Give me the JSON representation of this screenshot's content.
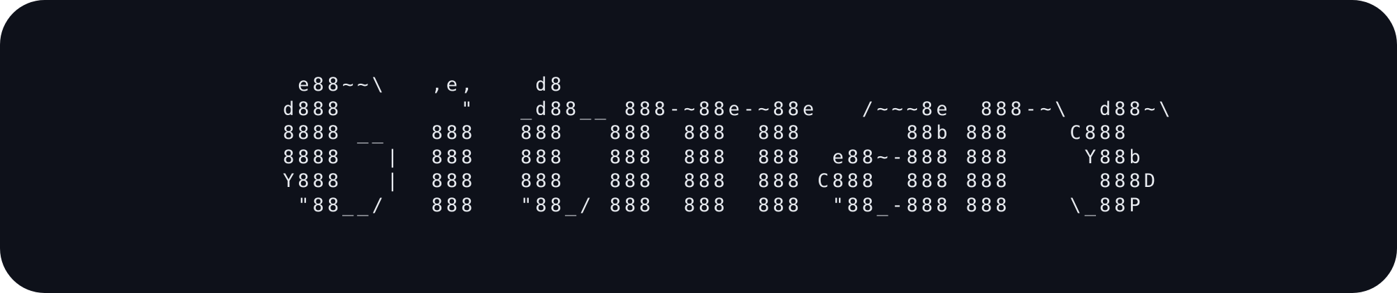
{
  "banner": {
    "background_color": "#0e111a",
    "text_color": "#e8ebf0",
    "ascii_art": " e88~~\\   ,e,    d8\nd888        \"   _d88__ 888-~88e-~88e   /~~~8e  888-~\\  d88~\\\n8888 __   888   888   888  888  888       88b 888    C888\n8888   |  888   888   888  888  888  e88~-888 888     Y88b\nY888   |  888   888   888  888  888 C888  888 888      888D\n \"88__/   888   \"88_/ 888  888  888  \"88_-888 888    \\_88P"
  }
}
